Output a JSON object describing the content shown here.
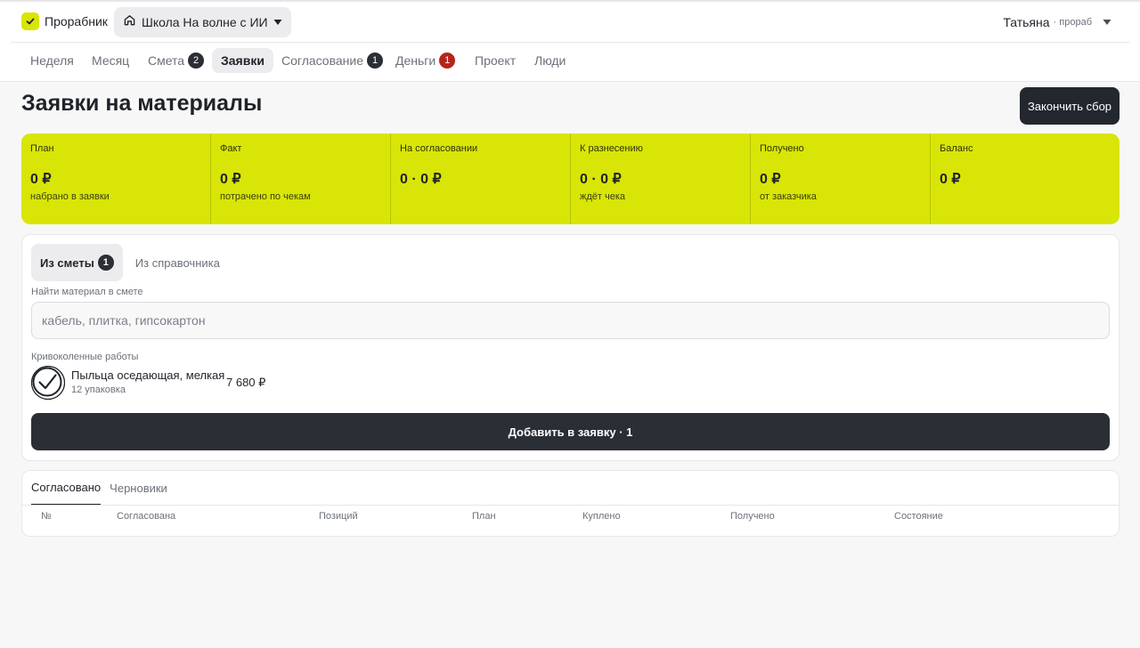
{
  "header": {
    "app_name": "Прорабник",
    "project_name": "Школа На волне с ИИ",
    "user_name": "Татьяна",
    "user_role": "· прораб"
  },
  "tabs": [
    {
      "label": "Неделя"
    },
    {
      "label": "Месяц"
    },
    {
      "label": "Смета",
      "badge": "2"
    },
    {
      "label": "Заявки",
      "active": true
    },
    {
      "label": "Согласование",
      "badge": "1"
    },
    {
      "label": "Деньги",
      "badge": "1",
      "badge_color": "#b4261c"
    },
    {
      "label": "Проект"
    },
    {
      "label": "Люди"
    }
  ],
  "page": {
    "title": "Заявки на материалы",
    "finish_button": "Закончить сбор"
  },
  "stats": [
    {
      "label": "План",
      "value": "0 ₽",
      "sub": "набрано в заявки"
    },
    {
      "label": "Факт",
      "value": "0 ₽",
      "sub": "потрачено по чекам"
    },
    {
      "label": "На согласовании",
      "value": "0 · 0 ₽",
      "sub": ""
    },
    {
      "label": "К разнесению",
      "value": "0 · 0 ₽",
      "sub": "ждёт чека"
    },
    {
      "label": "Получено",
      "value": "0 ₽",
      "sub": "от заказчика"
    },
    {
      "label": "Баланс",
      "value": "0 ₽",
      "sub": ""
    }
  ],
  "source_tabs": {
    "from_estimate": "Из сметы",
    "from_estimate_badge": "1",
    "from_catalog": "Из справочника"
  },
  "search": {
    "label": "Найти материал в смете",
    "placeholder": "кабель, плитка, гипсокартон"
  },
  "group": {
    "label": "Кривоколенные работы",
    "items": [
      {
        "name": "Пыльца оседающая, мелкая",
        "qty": "12 упаковка",
        "price": "7 680 ₽",
        "checked": true
      }
    ]
  },
  "add_button": "Добавить в заявку · 1",
  "requests": {
    "tabs": [
      "Согласовано",
      "Черновики"
    ],
    "columns": [
      "№",
      "Согласована",
      "Позиций",
      "План",
      "Куплено",
      "Получено",
      "Состояние"
    ]
  },
  "colors": {
    "accent": "#d9e506",
    "dark": "#23272e",
    "alert": "#b4261c"
  }
}
